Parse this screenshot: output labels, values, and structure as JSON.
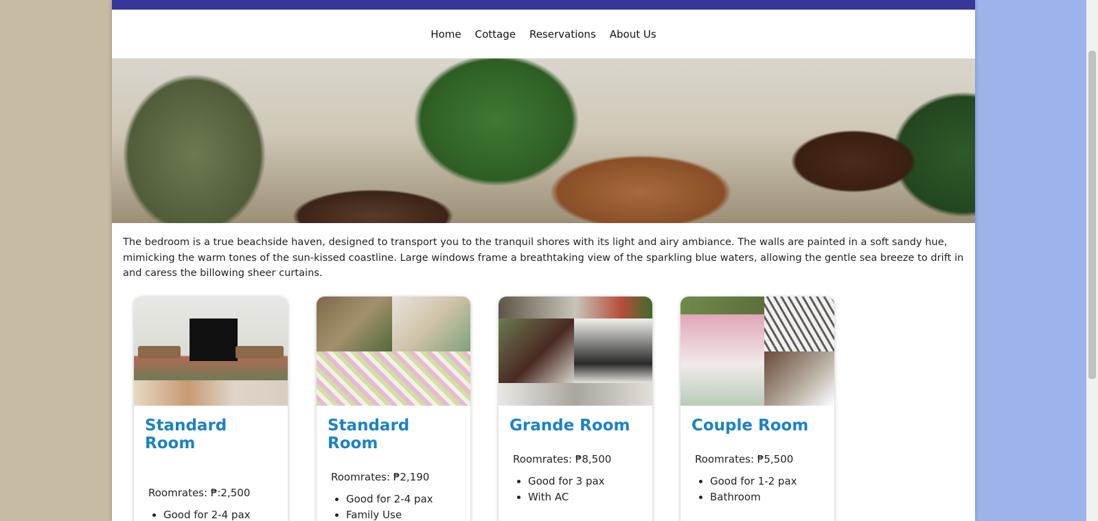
{
  "nav": {
    "items": [
      "Home",
      "Cottage",
      "Reservations",
      "About Us"
    ]
  },
  "description": "The bedroom is a true beachside haven, designed to transport you to the tranquil shores with its light and airy ambiance. The walls are painted in a soft sandy hue, mimicking the warm tones of the sun-kissed coastline. Large windows frame a breathtaking view of the sparkling blue waters, allowing the gentle sea breeze to drift in and caress the billowing sheer curtains.",
  "rooms": [
    {
      "title": "Standard Room",
      "rate": "Roomrates: ₱:2,500",
      "features": [
        "Good for 2-4 pax"
      ]
    },
    {
      "title": "Standard Room",
      "rate": "Roomrates: ₱2,190",
      "features": [
        "Good for 2-4 pax",
        "Family Use"
      ]
    },
    {
      "title": "Grande Room",
      "rate": "Roomrates: ₱8,500",
      "features": [
        "Good for 3 pax",
        "With AC"
      ]
    },
    {
      "title": "Couple Room",
      "rate": "Roomrates: ₱5,500",
      "features": [
        "Good for 1-2 pax",
        "Bathroom"
      ]
    }
  ],
  "colors": {
    "topbar": "#37369a",
    "room_title": "#1d82c2",
    "bg_left": "#c8bba4",
    "bg_right": "#9db3ea"
  }
}
